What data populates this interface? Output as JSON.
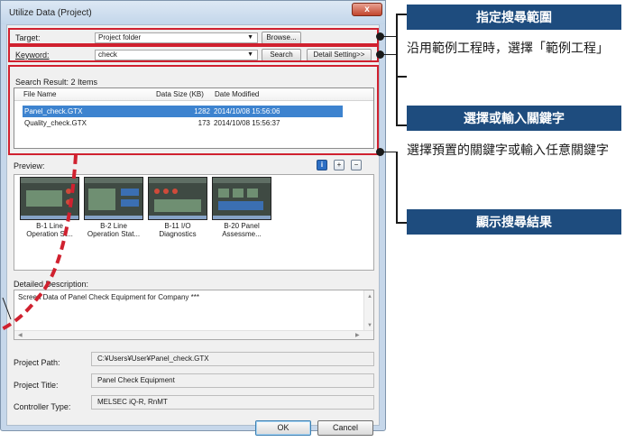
{
  "dialog": {
    "title": "Utilize Data (Project)",
    "close_label": "x"
  },
  "target": {
    "label": "Target:",
    "value": "Project folder",
    "browse_label": "Browse..."
  },
  "keyword": {
    "label": "Keyword:",
    "value": "check",
    "search_label": "Search",
    "detail_label": "Detail Setting>>"
  },
  "results": {
    "summary": "Search Result: 2 Items",
    "columns": [
      "File Name",
      "Data Size (KB)",
      "Date Modified"
    ],
    "rows": [
      {
        "name": "Panel_check.GTX",
        "size": "1282",
        "date": "2014/10/08 15:56:06",
        "selected": true
      },
      {
        "name": "Quality_check.GTX",
        "size": "173",
        "date": "2014/10/08 15:56:37",
        "selected": false
      }
    ]
  },
  "preview": {
    "label": "Preview:",
    "icons": [
      "info-icon",
      "zoom-in-icon",
      "zoom-out-icon"
    ],
    "thumbnails": [
      {
        "line1": "B-1 Line",
        "line2": "Operation St..."
      },
      {
        "line1": "B-2 Line",
        "line2": "Operation Stat..."
      },
      {
        "line1": "B-11 I/O",
        "line2": "Diagnostics"
      },
      {
        "line1": "B-20 Panel",
        "line2": "Assessme..."
      }
    ]
  },
  "details": {
    "label": "Detailed Description:",
    "text": "Screen Data of Panel Check Equipment for Company ***"
  },
  "fields": [
    {
      "label": "Project Path:",
      "value": "C:¥Users¥User¥Panel_check.GTX"
    },
    {
      "label": "Project Title:",
      "value": "Panel Check Equipment"
    },
    {
      "label": "Controller Type:",
      "value": "MELSEC iQ-R, RnMT"
    }
  ],
  "buttons": {
    "ok": "OK",
    "cancel": "Cancel"
  },
  "callouts": [
    {
      "title": "指定搜尋範圍",
      "text": "沿用範例工程時，選擇「範例工程」"
    },
    {
      "title": "選擇或輸入關鍵字",
      "text": "選擇預置的關鍵字或輸入任意關鍵字"
    },
    {
      "title": "顯示搜尋結果",
      "text": ""
    }
  ],
  "colors": {
    "callout_bg": "#1e4c7e",
    "highlight": "#d0212f",
    "selection": "#3d83cf"
  }
}
